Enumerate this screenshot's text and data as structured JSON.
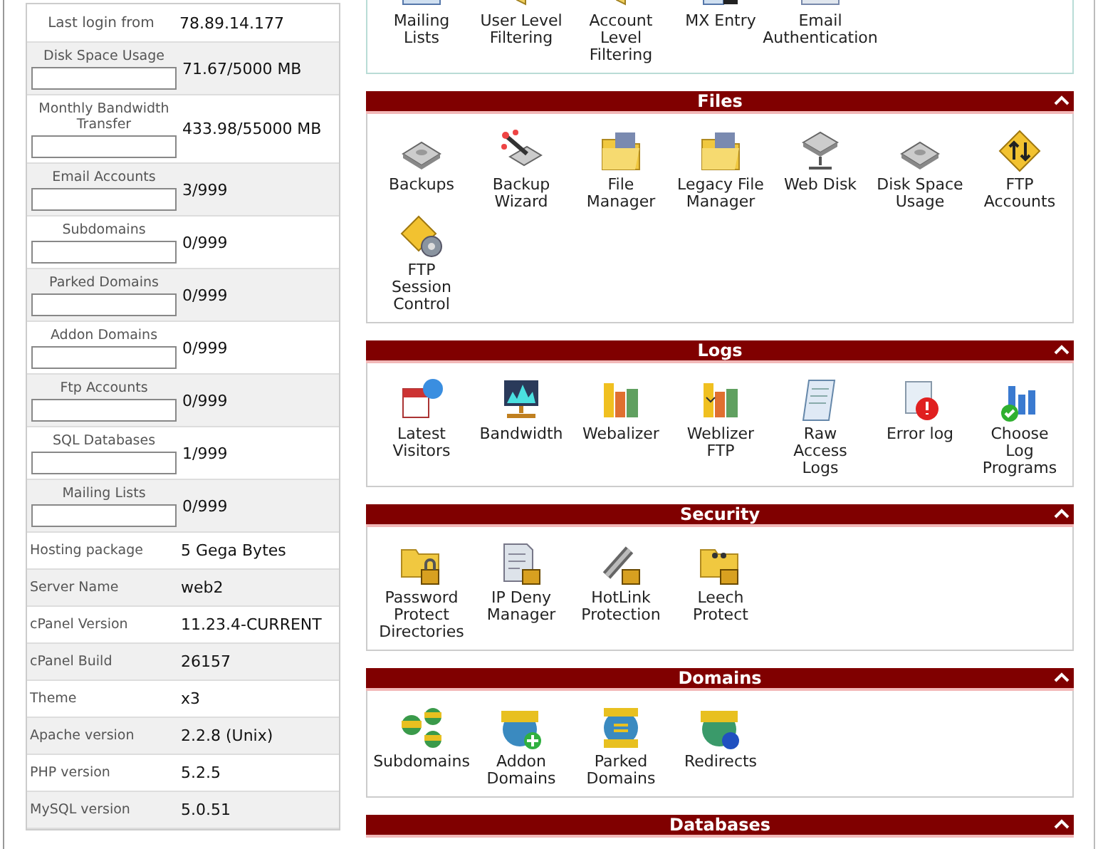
{
  "stats": [
    {
      "kind": "plain",
      "label": "Last login from",
      "value": "78.89.14.177"
    },
    {
      "kind": "bar",
      "label": "Disk Space Usage",
      "value": "71.67/5000 MB",
      "level": 0
    },
    {
      "kind": "bar",
      "label": "Monthly Bandwidth Transfer",
      "value": "433.98/55000 MB",
      "level": 0
    },
    {
      "kind": "bar",
      "label": "Email Accounts",
      "value": "3/999",
      "level": 0
    },
    {
      "kind": "bar",
      "label": "Subdomains",
      "value": "0/999",
      "level": 0
    },
    {
      "kind": "bar",
      "label": "Parked Domains",
      "value": "0/999",
      "level": 0
    },
    {
      "kind": "bar",
      "label": "Addon Domains",
      "value": "0/999",
      "level": 0
    },
    {
      "kind": "bar",
      "label": "Ftp Accounts",
      "value": "0/999",
      "level": 0
    },
    {
      "kind": "bar",
      "label": "SQL Databases",
      "value": "1/999",
      "level": 0
    },
    {
      "kind": "bar",
      "label": "Mailing Lists",
      "value": "0/999",
      "level": 0
    },
    {
      "kind": "info",
      "label": "Hosting package",
      "value": "5 Gega Bytes"
    },
    {
      "kind": "info",
      "label": "Server Name",
      "value": "web2"
    },
    {
      "kind": "info",
      "label": "cPanel Version",
      "value": "11.23.4-CURRENT"
    },
    {
      "kind": "info",
      "label": "cPanel Build",
      "value": "26157"
    },
    {
      "kind": "info",
      "label": "Theme",
      "value": "x3"
    },
    {
      "kind": "info",
      "label": "Apache version",
      "value": "2.2.8 (Unix)"
    },
    {
      "kind": "info",
      "label": "PHP version",
      "value": "5.2.5"
    },
    {
      "kind": "info",
      "label": "MySQL version",
      "value": "5.0.51"
    }
  ],
  "sections": [
    {
      "items": [
        "Mailing Lists",
        "User Level Filtering",
        "Account Level Filtering",
        "MX Entry",
        "Email Authentication"
      ]
    },
    {
      "title": "Files",
      "items": [
        "Backups",
        "Backup Wizard",
        "File Manager",
        "Legacy File Manager",
        "Web Disk",
        "Disk Space Usage",
        "FTP Accounts",
        "FTP Session Control"
      ]
    },
    {
      "title": "Logs",
      "items": [
        "Latest Visitors",
        "Bandwidth",
        "Webalizer",
        "Weblizer FTP",
        "Raw Access Logs",
        "Error log",
        "Choose Log Programs"
      ]
    },
    {
      "title": "Security",
      "items": [
        "Password Protect Directories",
        "IP Deny Manager",
        "HotLink Protection",
        "Leech Protect"
      ]
    },
    {
      "title": "Domains",
      "items": [
        "Subdomains",
        "Addon Domains",
        "Parked Domains",
        "Redirects"
      ]
    },
    {
      "title": "Databases"
    }
  ]
}
